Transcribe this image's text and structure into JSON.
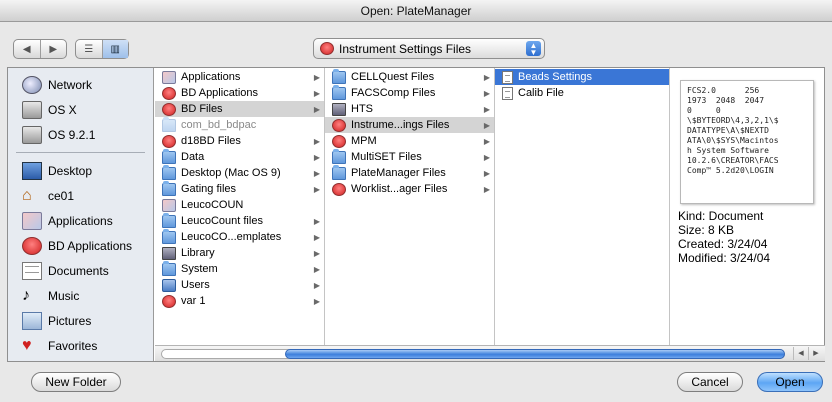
{
  "window": {
    "title": "Open: PlateManager"
  },
  "toolbar": {
    "back_icon": "back-arrow-icon",
    "forward_icon": "forward-arrow-icon",
    "list_view_icon": "list-view-icon",
    "column_view_icon": "column-view-icon",
    "location_popup": "Instrument Settings Files"
  },
  "sidebar": {
    "devices": [
      {
        "label": "Network",
        "icon": "network-icon"
      },
      {
        "label": "OS X",
        "icon": "hard-disk-icon"
      },
      {
        "label": "OS 9.2.1",
        "icon": "hard-disk-icon"
      }
    ],
    "places": [
      {
        "label": "Desktop",
        "icon": "desktop-icon"
      },
      {
        "label": "ce01",
        "icon": "home-icon"
      },
      {
        "label": "Applications",
        "icon": "applications-icon"
      },
      {
        "label": "BD Applications",
        "icon": "bd-folder-icon"
      },
      {
        "label": "Documents",
        "icon": "documents-icon"
      },
      {
        "label": "Music",
        "icon": "music-icon"
      },
      {
        "label": "Pictures",
        "icon": "pictures-icon"
      },
      {
        "label": "Favorites",
        "icon": "favorites-icon"
      }
    ]
  },
  "columns": {
    "col1": [
      {
        "label": "Applications",
        "icon": "app",
        "arrow": true
      },
      {
        "label": "BD Applications",
        "icon": "bd",
        "arrow": true
      },
      {
        "label": "BD Files",
        "icon": "bd",
        "arrow": true,
        "state": "parent"
      },
      {
        "label": "com_bd_bdpac",
        "icon": "faded",
        "arrow": false,
        "state": "dim"
      },
      {
        "label": "d18BD Files",
        "icon": "bd",
        "arrow": true
      },
      {
        "label": "Data",
        "icon": "folder",
        "arrow": true
      },
      {
        "label": "Desktop (Mac OS 9)",
        "icon": "folder",
        "arrow": true
      },
      {
        "label": "Gating files",
        "icon": "folder",
        "arrow": true
      },
      {
        "label": "LeucoCOUN",
        "icon": "app",
        "arrow": false
      },
      {
        "label": "LeucoCount files",
        "icon": "folder",
        "arrow": true
      },
      {
        "label": "LeucoCO...emplates",
        "icon": "folder",
        "arrow": true
      },
      {
        "label": "Library",
        "icon": "lib",
        "arrow": true
      },
      {
        "label": "System",
        "icon": "folder",
        "arrow": true
      },
      {
        "label": "Users",
        "icon": "users",
        "arrow": true
      },
      {
        "label": "var 1",
        "icon": "bd",
        "arrow": true
      }
    ],
    "col2": [
      {
        "label": "CELLQuest Files",
        "icon": "folder",
        "arrow": true
      },
      {
        "label": "FACSComp Files",
        "icon": "folder",
        "arrow": true
      },
      {
        "label": "HTS",
        "icon": "lib",
        "arrow": true
      },
      {
        "label": "Instrume...ings Files",
        "icon": "bd",
        "arrow": true,
        "state": "parent"
      },
      {
        "label": "MPM",
        "icon": "bd",
        "arrow": true
      },
      {
        "label": "MultiSET Files",
        "icon": "folder",
        "arrow": true
      },
      {
        "label": "PlateManager Files",
        "icon": "folder",
        "arrow": true
      },
      {
        "label": "Worklist...ager Files",
        "icon": "bd",
        "arrow": true
      }
    ],
    "col3": [
      {
        "label": "Beads Settings",
        "icon": "doc",
        "arrow": false,
        "state": "active"
      },
      {
        "label": "Calib File",
        "icon": "doc",
        "arrow": false
      }
    ]
  },
  "preview": {
    "thumbnail_lines": [
      "FCS2.0      256",
      "1973  2048  2047",
      "0     0",
      "\\$BYTEORD\\4,3,2,1\\$",
      "DATATYPE\\A\\$NEXTD",
      "ATA\\0\\$SYS\\Macintos",
      "h System Software",
      "10.2.6\\CREATOR\\FACS",
      "Comp™ 5.2d20\\LOGIN"
    ],
    "kind": "Kind: Document",
    "size": "Size: 8 KB",
    "created": "Created: 3/24/04",
    "modified": "Modified: 3/24/04"
  },
  "footer": {
    "new_folder": "New Folder",
    "cancel": "Cancel",
    "open": "Open"
  }
}
